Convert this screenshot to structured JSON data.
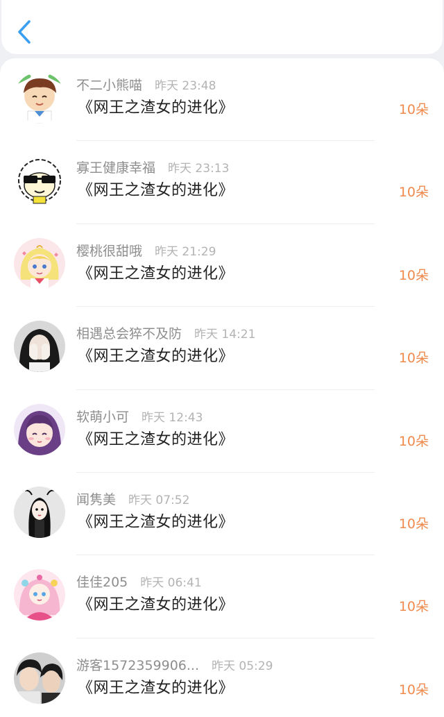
{
  "header": {
    "back_icon": "chevron-left-icon",
    "accent_color": "#3a9ff0"
  },
  "colors": {
    "amount": "#ef8a4c",
    "username": "#8e8e8e",
    "time": "#b3b3b3"
  },
  "records": [
    {
      "user": "不二小熊喵",
      "time": "昨天 23:48",
      "book": "《网王之渣女的进化》",
      "amount": "10朵",
      "avatar": "cartoon-boy-avatar"
    },
    {
      "user": "寡王健康幸福",
      "time": "昨天 23:13",
      "book": "《网王之渣女的进化》",
      "amount": "10朵",
      "avatar": "sheep-sunglasses-avatar"
    },
    {
      "user": "樱桃很甜哦",
      "time": "昨天 21:29",
      "book": "《网王之渣女的进化》",
      "amount": "10朵",
      "avatar": "anime-sailor-girl-avatar"
    },
    {
      "user": "相遇总会猝不及防",
      "time": "昨天 14:21",
      "book": "《网王之渣女的进化》",
      "amount": "10朵",
      "avatar": "girl-photo-avatar"
    },
    {
      "user": "软萌小可",
      "time": "昨天 12:43",
      "book": "《网王之渣女的进化》",
      "amount": "10朵",
      "avatar": "anime-purple-hair-avatar"
    },
    {
      "user": "闻隽美",
      "time": "昨天 07:52",
      "book": "《网王之渣女的进化》",
      "amount": "10朵",
      "avatar": "cartoon-girl-avatar"
    },
    {
      "user": "佳佳205",
      "time": "昨天 06:41",
      "book": "《网王之渣女的进化》",
      "amount": "10朵",
      "avatar": "anime-pink-girl-avatar"
    },
    {
      "user": "游客1572359906...",
      "time": "昨天 05:29",
      "book": "《网王之渣女的进化》",
      "amount": "10朵",
      "avatar": "two-boys-photo-avatar"
    }
  ]
}
